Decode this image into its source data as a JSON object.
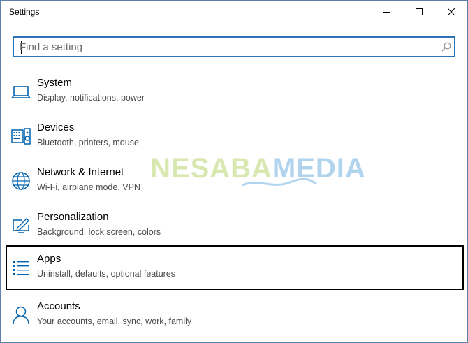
{
  "window": {
    "title": "Settings"
  },
  "search": {
    "placeholder": "Find a setting",
    "value": ""
  },
  "categories": [
    {
      "name": "System",
      "desc": "Display, notifications, power",
      "icon": "laptop-icon"
    },
    {
      "name": "Devices",
      "desc": "Bluetooth, printers, mouse",
      "icon": "keyboard-speaker-icon"
    },
    {
      "name": "Network & Internet",
      "desc": "Wi-Fi, airplane mode, VPN",
      "icon": "globe-icon"
    },
    {
      "name": "Personalization",
      "desc": "Background, lock screen, colors",
      "icon": "paint-screen-icon"
    },
    {
      "name": "Apps",
      "desc": "Uninstall, defaults, optional features",
      "icon": "apps-list-icon"
    },
    {
      "name": "Accounts",
      "desc": "Your accounts, email, sync, work, family",
      "icon": "person-icon"
    }
  ],
  "selected_category": "Apps",
  "watermark": {
    "part1": "NESABA",
    "part2": "MEDIA"
  },
  "colors": {
    "accent": "#2b73b8",
    "icon_blue": "#0063b1",
    "selection_border": "#000000"
  }
}
